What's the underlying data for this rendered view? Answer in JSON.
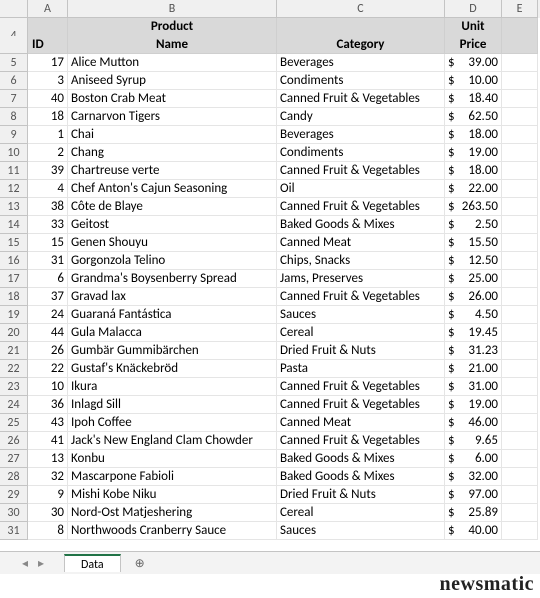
{
  "columns": [
    "A",
    "B",
    "C",
    "D",
    "E"
  ],
  "header_start_row": 4,
  "table_header": {
    "id": "ID",
    "product_line1": "Product",
    "product_line2": "Name",
    "category": "Category",
    "price_line1": "Unit",
    "price_line2": "Price"
  },
  "rows": [
    {
      "n": 5,
      "id": 17,
      "name": "Alice Mutton",
      "cat": "Beverages",
      "price": "39.00"
    },
    {
      "n": 6,
      "id": 3,
      "name": "Aniseed Syrup",
      "cat": "Condiments",
      "price": "10.00"
    },
    {
      "n": 7,
      "id": 40,
      "name": "Boston Crab Meat",
      "cat": "Canned Fruit & Vegetables",
      "price": "18.40"
    },
    {
      "n": 8,
      "id": 18,
      "name": "Carnarvon Tigers",
      "cat": "Candy",
      "price": "62.50"
    },
    {
      "n": 9,
      "id": 1,
      "name": "Chai",
      "cat": "Beverages",
      "price": "18.00"
    },
    {
      "n": 10,
      "id": 2,
      "name": "Chang",
      "cat": "Condiments",
      "price": "19.00"
    },
    {
      "n": 11,
      "id": 39,
      "name": "Chartreuse verte",
      "cat": "Canned Fruit & Vegetables",
      "price": "18.00"
    },
    {
      "n": 12,
      "id": 4,
      "name": "Chef Anton's Cajun Seasoning",
      "cat": "Oil",
      "price": "22.00"
    },
    {
      "n": 13,
      "id": 38,
      "name": "Côte de Blaye",
      "cat": "Canned Fruit & Vegetables",
      "price": "263.50"
    },
    {
      "n": 14,
      "id": 33,
      "name": "Geitost",
      "cat": "Baked Goods & Mixes",
      "price": "2.50"
    },
    {
      "n": 15,
      "id": 15,
      "name": "Genen Shouyu",
      "cat": "Canned Meat",
      "price": "15.50"
    },
    {
      "n": 16,
      "id": 31,
      "name": "Gorgonzola Telino",
      "cat": "Chips, Snacks",
      "price": "12.50"
    },
    {
      "n": 17,
      "id": 6,
      "name": "Grandma's Boysenberry Spread",
      "cat": "Jams, Preserves",
      "price": "25.00"
    },
    {
      "n": 18,
      "id": 37,
      "name": "Gravad lax",
      "cat": "Canned Fruit & Vegetables",
      "price": "26.00"
    },
    {
      "n": 19,
      "id": 24,
      "name": "Guaraná Fantástica",
      "cat": "Sauces",
      "price": "4.50"
    },
    {
      "n": 20,
      "id": 44,
      "name": "Gula Malacca",
      "cat": "Cereal",
      "price": "19.45"
    },
    {
      "n": 21,
      "id": 26,
      "name": "Gumbär Gummibärchen",
      "cat": "Dried Fruit & Nuts",
      "price": "31.23"
    },
    {
      "n": 22,
      "id": 22,
      "name": "Gustaf's Knäckebröd",
      "cat": "Pasta",
      "price": "21.00"
    },
    {
      "n": 23,
      "id": 10,
      "name": "Ikura",
      "cat": "Canned Fruit & Vegetables",
      "price": "31.00"
    },
    {
      "n": 24,
      "id": 36,
      "name": "Inlagd Sill",
      "cat": "Canned Fruit & Vegetables",
      "price": "19.00"
    },
    {
      "n": 25,
      "id": 43,
      "name": "Ipoh Coffee",
      "cat": "Canned Meat",
      "price": "46.00"
    },
    {
      "n": 26,
      "id": 41,
      "name": "Jack's New England Clam Chowder",
      "cat": "Canned Fruit & Vegetables",
      "price": "9.65"
    },
    {
      "n": 27,
      "id": 13,
      "name": "Konbu",
      "cat": "Baked Goods & Mixes",
      "price": "6.00"
    },
    {
      "n": 28,
      "id": 32,
      "name": "Mascarpone Fabioli",
      "cat": "Baked Goods & Mixes",
      "price": "32.00"
    },
    {
      "n": 29,
      "id": 9,
      "name": "Mishi Kobe Niku",
      "cat": "Dried Fruit & Nuts",
      "price": "97.00"
    },
    {
      "n": 30,
      "id": 30,
      "name": "Nord-Ost Matjeshering",
      "cat": "Cereal",
      "price": "25.89"
    },
    {
      "n": 31,
      "id": 8,
      "name": "Northwoods Cranberry Sauce",
      "cat": "Sauces",
      "price": "40.00"
    }
  ],
  "currency_symbol": "$",
  "sheet_tab": "Data",
  "watermark": "newsmatic"
}
